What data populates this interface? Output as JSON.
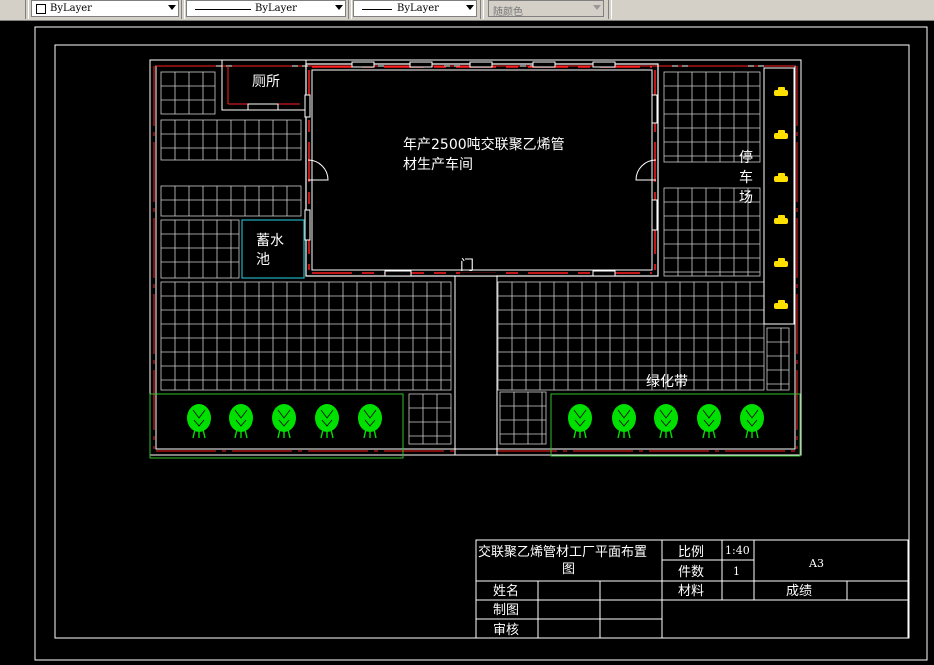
{
  "toolbar": {
    "color_combo": "ByLayer",
    "linetype_combo": "ByLayer",
    "lineweight_combo": "ByLayer",
    "plotstyle_combo": "随颜色"
  },
  "drawing": {
    "rooms": {
      "toilet": "厕所",
      "workshop_line1": "年产2500吨交联聚乙烯管",
      "workshop_line2": "材生产车间",
      "pool_line1": "蓄水",
      "pool_line2": "池",
      "gate": "门",
      "parking_1": "停",
      "parking_2": "车",
      "parking_3": "场",
      "green_belt": "绿化带"
    },
    "colors": {
      "wall": "#ffffff",
      "window": "#ff2020",
      "tree": "#00e000",
      "green_border": "#30c030",
      "pool_border": "#20b0c0",
      "car": "#ffe000"
    }
  },
  "title_block": {
    "title_line1": "交联聚乙烯管材工厂平面布置",
    "title_line2": "图",
    "scale_label": "比例",
    "scale_value": "1:40",
    "count_label": "件数",
    "count_value": "1",
    "paper_size": "A3",
    "material_label": "材料",
    "grade_label": "成绩",
    "name_label": "姓名",
    "drawn_label": "制图",
    "review_label": "审核"
  }
}
